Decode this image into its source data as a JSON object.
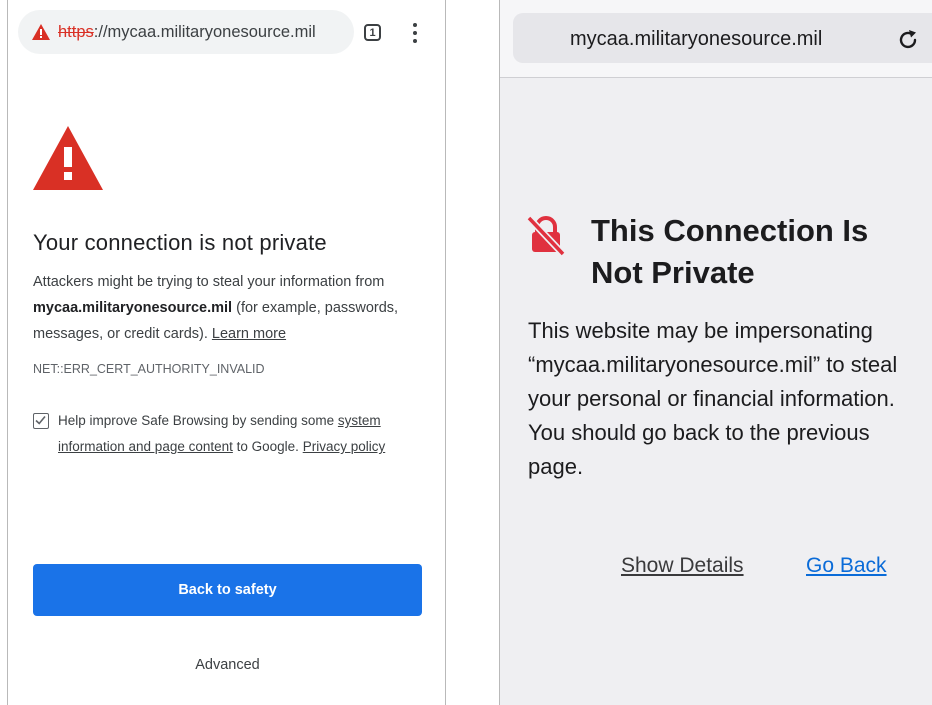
{
  "chrome": {
    "url_scheme": "https",
    "url_rest": "://mycaa.militaryonesource.mil",
    "tab_count": "1",
    "title": "Your connection is not private",
    "para_lead": "Attackers might be trying to steal your information from",
    "para_domain": "mycaa.militaryonesource.mil",
    "para_tail": "(for example, passwords, messages, or credit cards).",
    "learn_more": "Learn more",
    "error_code": "NET::ERR_CERT_AUTHORITY_INVALID",
    "safe_browsing_lead": "Help improve Safe Browsing by sending some",
    "safe_browsing_link": "system information and page content",
    "safe_browsing_mid": "to Google.",
    "privacy_policy": "Privacy policy",
    "back_to_safety": "Back to safety",
    "advanced": "Advanced",
    "checkbox_checked": true,
    "colors": {
      "warning_red": "#d93025",
      "primary_blue": "#1a73e8"
    },
    "icons": [
      "warning-triangle-icon",
      "tab-switcher-icon",
      "kebab-menu-icon",
      "checkbox-checked-icon"
    ]
  },
  "safari": {
    "url": "mycaa.militaryonesource.mil",
    "title": "This Connection Is Not Private",
    "body": "This website may be impersonating “mycaa.militaryonesource.mil” to steal your personal or financial information. You should go back to the previous page.",
    "show_details": "Show Details",
    "go_back": "Go Back",
    "colors": {
      "lock_red": "#e0313f",
      "link_blue": "#0a6bd8"
    },
    "icons": [
      "reload-icon",
      "lock-slash-icon"
    ]
  }
}
